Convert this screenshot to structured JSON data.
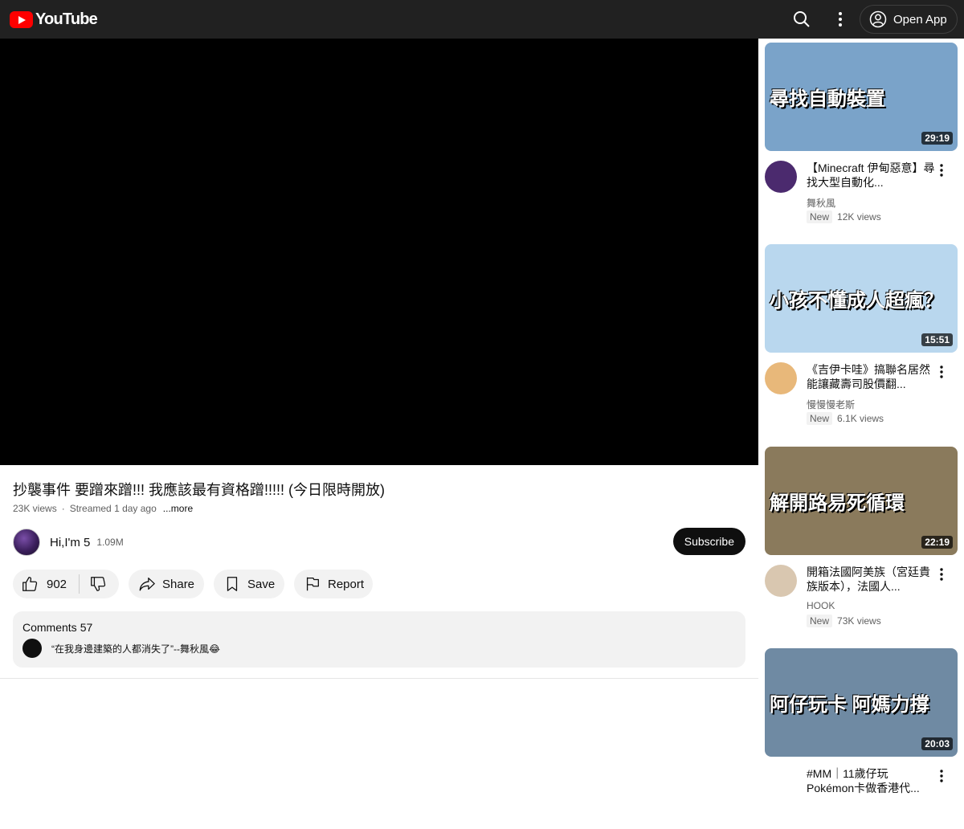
{
  "header": {
    "logo_text": "YouTube",
    "open_app_label": "Open App"
  },
  "video": {
    "title": "抄襲事件 要蹭來蹭!!! 我應該最有資格蹭!!!!! (今日限時開放)",
    "views": "23K views",
    "streamed": "Streamed 1 day ago",
    "more_label": "...more"
  },
  "channel": {
    "name": "Hi,I'm 5",
    "subscribers": "1.09M",
    "subscribe_label": "Subscribe"
  },
  "actions": {
    "like_count": "902",
    "share_label": "Share",
    "save_label": "Save",
    "report_label": "Report"
  },
  "comments": {
    "label": "Comments",
    "count": "57",
    "top_comment": "“在我身邊建築的人都消失了”--舞秋風😂"
  },
  "sidebar": {
    "cards": [
      {
        "thumb_caption": "尋找自動裝置",
        "duration": "29:19",
        "title": "【Minecraft 伊甸惡意】尋找大型自動化...",
        "channel": "舞秋風",
        "badge": "New",
        "views": "12K views",
        "thumb_color": "#7aa3c9",
        "avatar_color": "#4b2a6e"
      },
      {
        "thumb_caption": "小孩不懂成人超瘋？",
        "duration": "15:51",
        "title": "《吉伊卡哇》搞聯名居然能讓藏壽司股價翻...",
        "channel": "慢慢慢老斯",
        "badge": "New",
        "views": "6.1K views",
        "thumb_color": "#b9d7ee",
        "avatar_color": "#e8b87a"
      },
      {
        "thumb_caption": "解開路易死循環",
        "duration": "22:19",
        "title": "開箱法國阿美族（宮廷貴族版本），法國人...",
        "channel": "HOOK",
        "badge": "New",
        "views": "73K views",
        "thumb_color": "#8a7a5c",
        "avatar_color": "#d9c7b0"
      },
      {
        "thumb_caption": "阿仔玩卡 阿媽力撐",
        "duration": "20:03",
        "title": "#MM｜11歲仔玩Pokémon卡做香港代...",
        "channel": "",
        "badge": "",
        "views": "",
        "thumb_color": "#6f8aa3",
        "avatar_color": "#ffffff"
      }
    ]
  }
}
